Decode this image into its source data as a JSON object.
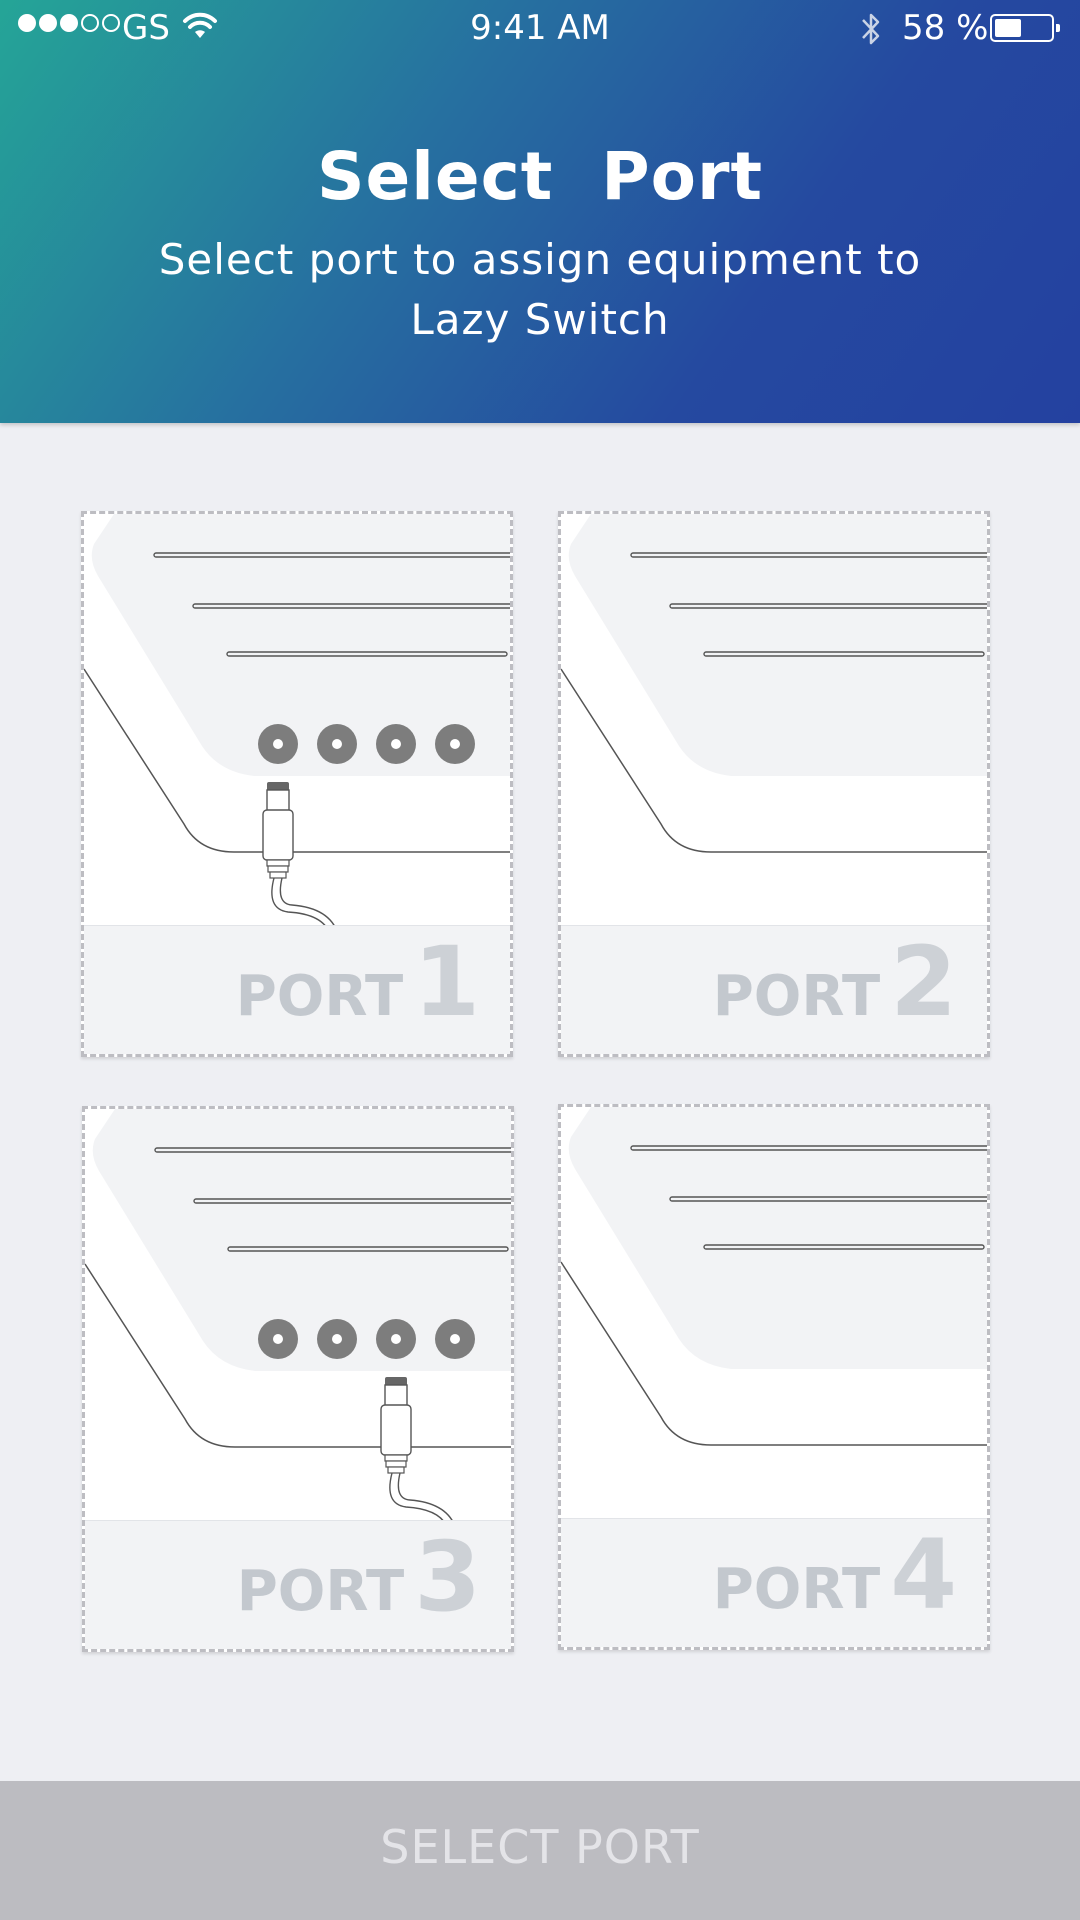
{
  "status_bar": {
    "signal_dots": 5,
    "signal_filled": 3,
    "carrier": "GS",
    "time": "9:41 AM",
    "bluetooth": true,
    "battery_percent": "58 %",
    "battery_level": 0.58
  },
  "header": {
    "title": "Select  Port",
    "subtitle": "Select port to assign equipment to Lazy Switch"
  },
  "ports": [
    {
      "label": "PORT",
      "number": "1",
      "plugged_port": 1
    },
    {
      "label": "PORT",
      "number": "2",
      "plugged_port": 2
    },
    {
      "label": "PORT",
      "number": "3",
      "plugged_port": 3
    },
    {
      "label": "PORT",
      "number": "4",
      "plugged_port": 4
    }
  ],
  "footer": {
    "button_label": "SELECT PORT"
  },
  "colors": {
    "header_gradient_start": "#25a597",
    "header_gradient_end": "#2441a0",
    "page_background": "#eeeff3",
    "button_disabled": "#bcbcc1",
    "port_label": "#c3c8ce",
    "port_dot": "#7d7d7d"
  }
}
